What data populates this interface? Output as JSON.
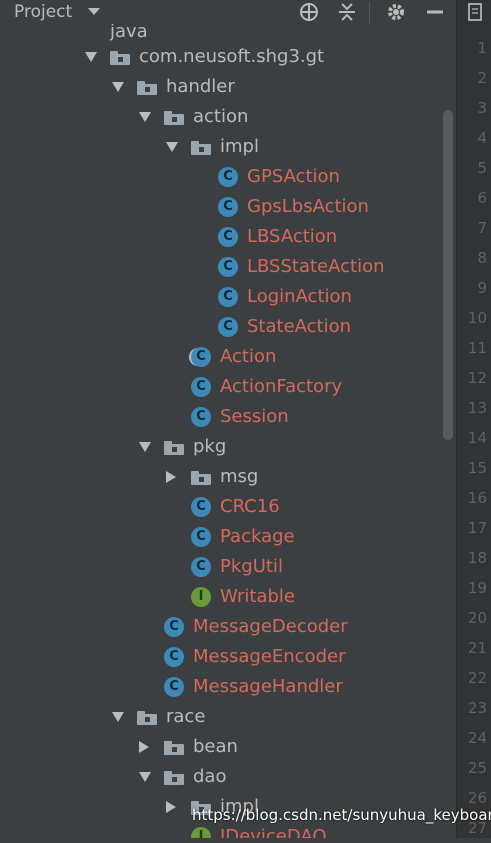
{
  "toolbar": {
    "title": "Project",
    "icons": [
      "project-view-icon",
      "crosshair-icon",
      "collapse-all-icon",
      "gear-icon",
      "hide-icon"
    ]
  },
  "tree": {
    "top_partial": "java",
    "items": [
      {
        "label": "com.neusoft.shg3.gt",
        "kind": "package",
        "expanded": true
      },
      {
        "label": "handler",
        "kind": "package",
        "expanded": true
      },
      {
        "label": "action",
        "kind": "package",
        "expanded": true
      },
      {
        "label": "impl",
        "kind": "package",
        "expanded": true
      },
      {
        "label": "GPSAction",
        "kind": "class"
      },
      {
        "label": "GpsLbsAction",
        "kind": "class"
      },
      {
        "label": "LBSAction",
        "kind": "class"
      },
      {
        "label": "LBSStateAction",
        "kind": "class"
      },
      {
        "label": "LoginAction",
        "kind": "class"
      },
      {
        "label": "StateAction",
        "kind": "class"
      },
      {
        "label": "Action",
        "kind": "abstract-class"
      },
      {
        "label": "ActionFactory",
        "kind": "class"
      },
      {
        "label": "Session",
        "kind": "class"
      },
      {
        "label": "pkg",
        "kind": "package",
        "expanded": true
      },
      {
        "label": "msg",
        "kind": "package",
        "expanded": false
      },
      {
        "label": "CRC16",
        "kind": "class"
      },
      {
        "label": "Package",
        "kind": "class"
      },
      {
        "label": "PkgUtil",
        "kind": "class"
      },
      {
        "label": "Writable",
        "kind": "interface"
      },
      {
        "label": "MessageDecoder",
        "kind": "class"
      },
      {
        "label": "MessageEncoder",
        "kind": "class"
      },
      {
        "label": "MessageHandler",
        "kind": "class"
      },
      {
        "label": "race",
        "kind": "package",
        "expanded": true
      },
      {
        "label": "bean",
        "kind": "package",
        "expanded": false
      },
      {
        "label": "dao",
        "kind": "package",
        "expanded": true
      },
      {
        "label": "impl",
        "kind": "package",
        "expanded": false
      },
      {
        "label": "IDeviceDAO",
        "kind": "interface"
      }
    ]
  },
  "gutter": {
    "line_numbers": [
      "1",
      "2",
      "3",
      "4",
      "5",
      "6",
      "7",
      "8",
      "9",
      "10",
      "11",
      "12",
      "13",
      "14",
      "15",
      "16",
      "17",
      "18",
      "19",
      "20",
      "21",
      "22",
      "23",
      "24",
      "25",
      "26",
      "27"
    ]
  },
  "icon_glyphs": {
    "class": "C",
    "interface": "I"
  },
  "watermark": "https://blog.csdn.net/sunyuhua_keyboard",
  "colors": {
    "background": "#3c3f41",
    "package_text": "#bbbbbb",
    "class_text": "#d46a5b",
    "class_icon": "#3d8ab8",
    "interface_icon": "#6a9a3a"
  }
}
